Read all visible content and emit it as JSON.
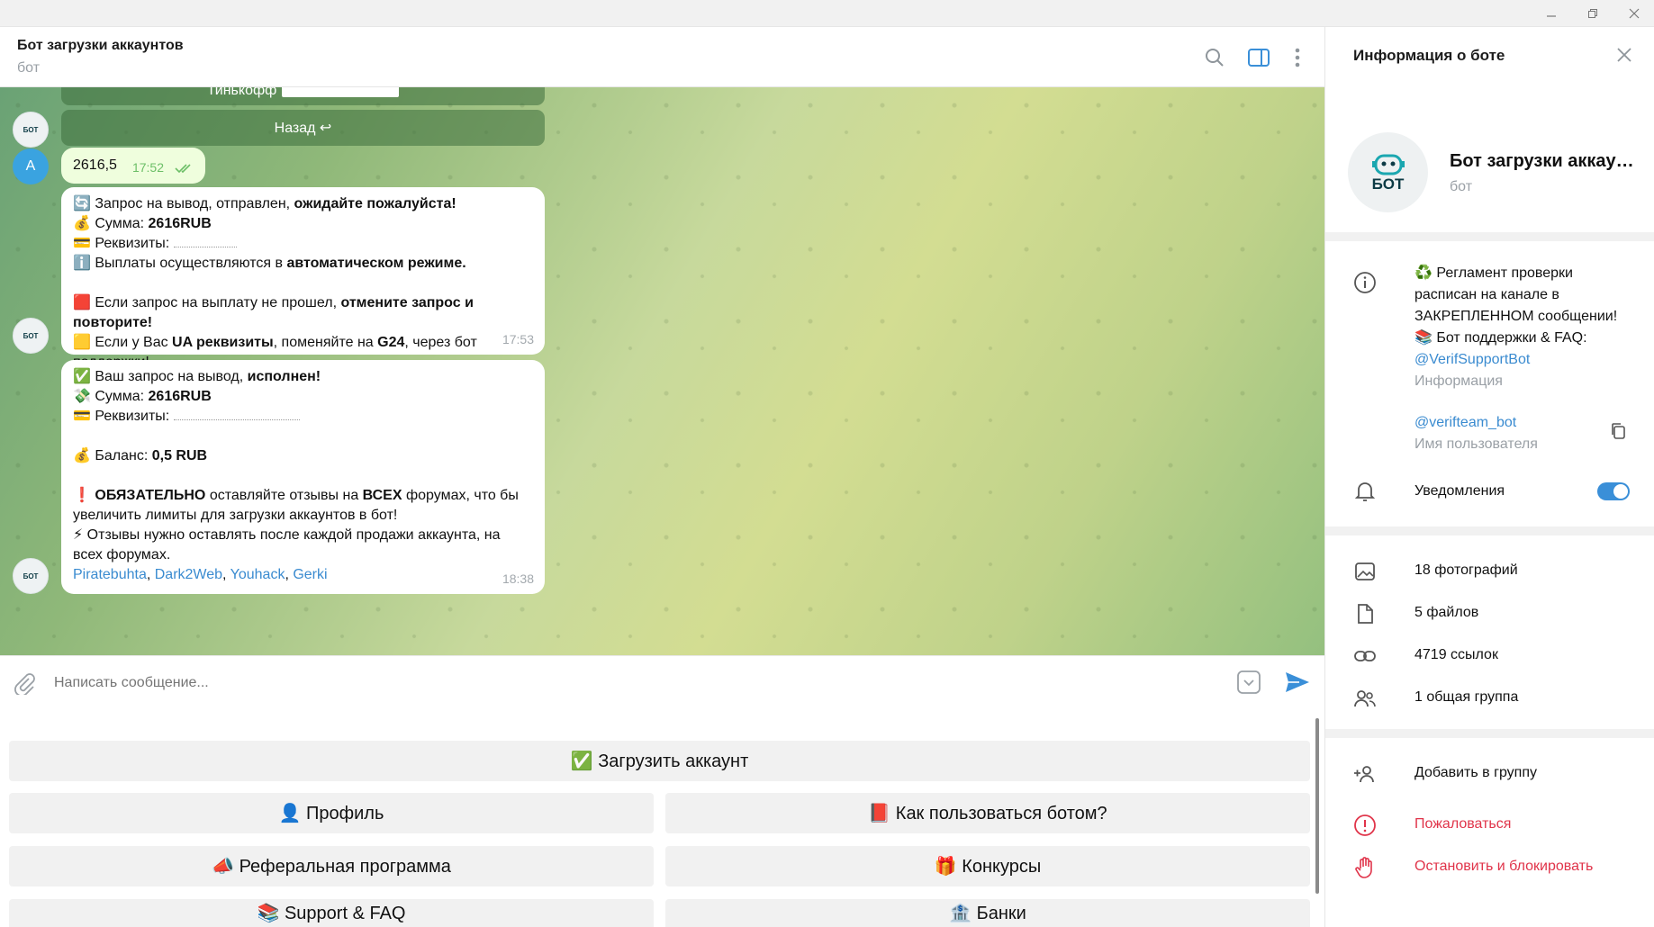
{
  "window": {
    "minimize": "—",
    "restore": "❐",
    "close": "✕"
  },
  "header": {
    "title": "Бот загрузки аккаунтов",
    "subtitle": "бот"
  },
  "messages": {
    "inline_partial_label": "Тинькофф",
    "back_button": "Назад ↩",
    "user_initial": "A",
    "user_msg_text": "2616,5",
    "user_msg_time": "17:52",
    "bot_avatar_text": "БОТ",
    "msg1": {
      "line1_a": "🔄 Запрос на вывод,  отправлен, ",
      "line1_b": "ожидайте пожалуйста!",
      "line2_a": "💰 Сумма: ",
      "line2_b": "2616RUB",
      "line3": "💳 Реквизиты: ",
      "line4_a": "ℹ️ Выплаты осуществляются в ",
      "line4_b": "автоматическом режиме.",
      "line5_a": "🟥 Если запрос на выплату не прошел, ",
      "line5_b": "отмените запрос и повторите!",
      "line6_a": "🟨 Если у Вас ",
      "line6_b": "UA реквизиты",
      "line6_c": ", поменяйте на ",
      "line6_d": "G24",
      "line6_e": ", через бот поддержки!",
      "time": "17:53"
    },
    "msg2": {
      "line1_a": "✅ Ваш запрос на вывод, ",
      "line1_b": "исполнен!",
      "line2_a": "💸 Сумма: ",
      "line2_b": "2616RUB",
      "line3": "💳 Реквизиты: ",
      "line4_a": "💰 Баланс: ",
      "line4_b": "0,5 RUB",
      "line5_a": "❗ ",
      "line5_b": "ОБЯЗАТЕЛЬНО",
      "line5_c": " оставляйте отзывы на ",
      "line5_d": "ВСЕХ",
      "line5_e": " форумах, что бы увеличить лимиты для загрузки аккаунтов в бот!",
      "line6": "⚡ Отзывы нужно оставлять после каждой продажи аккаунта, на всех форумах.",
      "links": [
        "Piratebuhta",
        "Dark2Web",
        "Youhack",
        "Gerki"
      ],
      "sep": ", ",
      "time": "18:38"
    }
  },
  "composer": {
    "placeholder": "Написать сообщение..."
  },
  "keyboard": {
    "upload": "✅ Загрузить аккаунт",
    "profile": "👤 Профиль",
    "howto": "📕 Как пользоваться ботом?",
    "referral": "📣 Реферальная программа",
    "contests": "🎁 Конкурсы",
    "support": "📚 Support & FAQ",
    "banks": "🏦 Банки"
  },
  "sidebar": {
    "title": "Информация о боте",
    "name": "Бот загрузки аккаунтов",
    "type": "бот",
    "avatar_text": "БОТ",
    "info_text_1": "♻️ Регламент проверки расписан на канале в ЗАКРЕПЛЕННОМ сообщении!",
    "info_text_2": "📚 Бот поддержки & FAQ:",
    "info_link": "@VerifSupportBot",
    "info_label": "Информация",
    "username": "@verifteam_bot",
    "username_label": "Имя пользователя",
    "notifications": "Уведомления",
    "notifications_on": true,
    "media": {
      "photos": "18 фотографий",
      "files": "5 файлов",
      "links": "4719 ссылок",
      "groups": "1 общая группа"
    },
    "add_to_group": "Добавить в группу",
    "report": "Пожаловаться",
    "block": "Остановить и блокировать"
  },
  "colors": {
    "accent": "#3a8fd8",
    "danger": "#e0344a",
    "outgoing_bubble": "#effedd"
  }
}
